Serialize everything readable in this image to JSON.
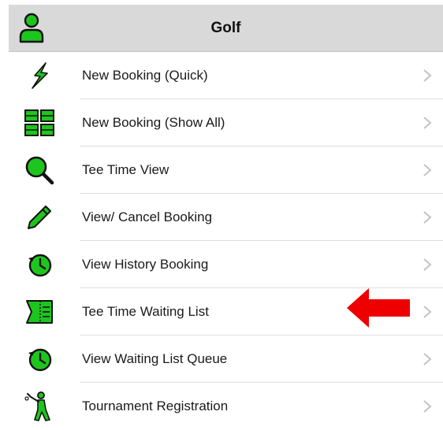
{
  "header": {
    "title": "Golf",
    "icon": "user-icon"
  },
  "colors": {
    "icon_green": "#1ec51e",
    "icon_outline": "#111111",
    "header_bg": "#d9d9d9",
    "arrow_red": "#ee0000",
    "chevron": "#c3c3c3"
  },
  "menu": {
    "items": [
      {
        "label": "New Booking (Quick)",
        "icon": "lightning-icon"
      },
      {
        "label": "New Booking (Show All)",
        "icon": "grid-icon"
      },
      {
        "label": "Tee Time View",
        "icon": "search-icon"
      },
      {
        "label": "View/ Cancel Booking",
        "icon": "pencil-icon"
      },
      {
        "label": "View History Booking",
        "icon": "clock-history-icon"
      },
      {
        "label": "Tee Time Waiting List",
        "icon": "ticket-list-icon"
      },
      {
        "label": "View Waiting List Queue",
        "icon": "clock-queue-icon"
      },
      {
        "label": "Tournament Registration",
        "icon": "golfer-icon"
      }
    ]
  },
  "annotation": {
    "icon": "red-arrow-left-icon",
    "points_to": "Tee Time Waiting List"
  }
}
